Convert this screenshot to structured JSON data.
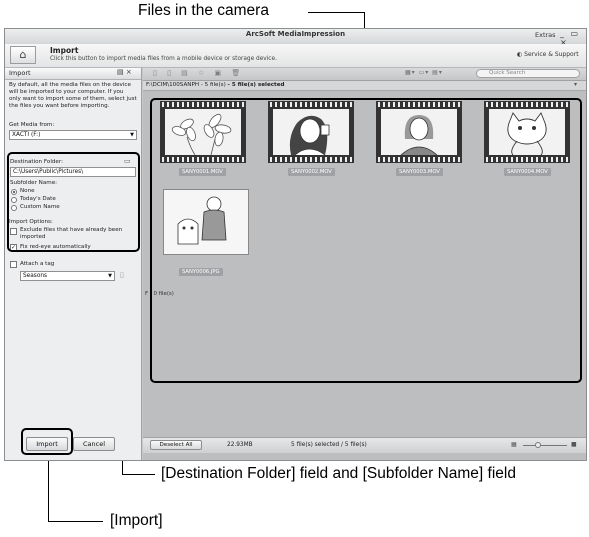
{
  "callouts": {
    "files": "Files in the camera",
    "destination": "[Destination Folder] field and [Subfolder Name] field",
    "import": "[Import]"
  },
  "window": {
    "title": "ArcSoft MediaImpression",
    "extras": "Extras",
    "controls": "_ ▭ ×"
  },
  "header": {
    "title": "Import",
    "description": "Click this button to import media files from a mobile device or storage device.",
    "service": "Service & Support"
  },
  "left_panel": {
    "title": "Import",
    "intro": "By default, all the media files on the device will be imported to your computer. If you only want to import some of them, select just the files you want before importing.",
    "get_media_label": "Get Media from:",
    "get_media_value": "XACTI (F:)",
    "destination_label": "Destination Folder:",
    "destination_value": "C:\\Users\\Public\\Pictures\\",
    "subfolder_label": "Subfolder Name:",
    "subfolder_options": [
      "None",
      "Today's Date",
      "Custom Name"
    ],
    "import_options_label": "Import Options:",
    "exclude_label": "Exclude files that have already been imported",
    "redeye_label": "Fix red-eye automatically",
    "attach_tag_label": "Attach a tag",
    "tag_value": "Seasons",
    "import_button": "Import",
    "cancel_button": "Cancel"
  },
  "main": {
    "search_placeholder": "Quick Search",
    "path": "F:\\DCIM\\100SANPH - 5 file(s)",
    "selected": "- 5 file(s) selected",
    "files": [
      "SANY0001.MOV",
      "SANY0002.MOV",
      "SANY0003.MOV",
      "SANY0004.MOV",
      "SANY0006.JPG"
    ],
    "group2": "F - 0 file(s)"
  },
  "status": {
    "deselect": "Deselect All",
    "size": "22.93MB",
    "count": "5 file(s) selected / 5 file(s)"
  }
}
